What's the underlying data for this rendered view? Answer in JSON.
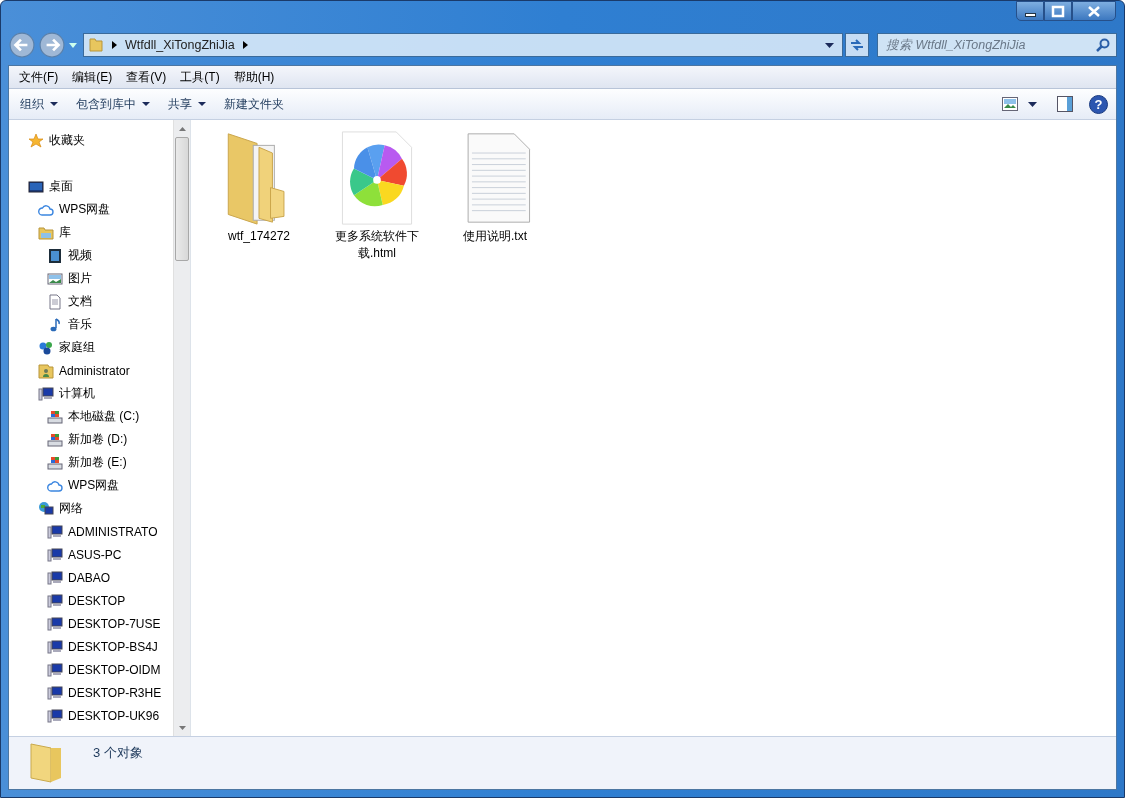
{
  "address_bar": {
    "path": "Wtfdll_XiTongZhiJia"
  },
  "search": {
    "placeholder": "搜索 Wtfdll_XiTongZhiJia"
  },
  "menu_bar": [
    "文件(F)",
    "编辑(E)",
    "查看(V)",
    "工具(T)",
    "帮助(H)"
  ],
  "toolbar": [
    {
      "label": "组织",
      "dropdown": true
    },
    {
      "label": "包含到库中",
      "dropdown": true
    },
    {
      "label": "共享",
      "dropdown": true
    },
    {
      "label": "新建文件夹",
      "dropdown": false
    }
  ],
  "help_button": {
    "label": "?"
  },
  "sidebar": {
    "groups": [
      {
        "items": [
          {
            "label": "收藏夹",
            "kind": "star"
          }
        ]
      },
      {
        "items": [
          {
            "label": "桌面",
            "kind": "desktop",
            "children": [
              {
                "label": "WPS网盘",
                "kind": "cloud"
              },
              {
                "label": "库",
                "kind": "library",
                "children": [
                  {
                    "label": "视频",
                    "kind": "video"
                  },
                  {
                    "label": "图片",
                    "kind": "picture"
                  },
                  {
                    "label": "文档",
                    "kind": "document"
                  },
                  {
                    "label": "音乐",
                    "kind": "music"
                  }
                ]
              },
              {
                "label": "家庭组",
                "kind": "homegroup"
              },
              {
                "label": "Administrator",
                "kind": "user"
              },
              {
                "label": "计算机",
                "kind": "computer",
                "children": [
                  {
                    "label": "本地磁盘 (C:)",
                    "kind": "drive"
                  },
                  {
                    "label": "新加卷 (D:)",
                    "kind": "drive"
                  },
                  {
                    "label": "新加卷 (E:)",
                    "kind": "drive"
                  },
                  {
                    "label": "WPS网盘",
                    "kind": "cloud"
                  }
                ]
              },
              {
                "label": "网络",
                "kind": "network",
                "children": [
                  {
                    "label": "ADMINISTRATO",
                    "kind": "computer"
                  },
                  {
                    "label": "ASUS-PC",
                    "kind": "computer"
                  },
                  {
                    "label": "DABAO",
                    "kind": "computer"
                  },
                  {
                    "label": "DESKTOP",
                    "kind": "computer"
                  },
                  {
                    "label": "DESKTOP-7USE",
                    "kind": "computer"
                  },
                  {
                    "label": "DESKTOP-BS4J",
                    "kind": "computer"
                  },
                  {
                    "label": "DESKTOP-OIDM",
                    "kind": "computer"
                  },
                  {
                    "label": "DESKTOP-R3HE",
                    "kind": "computer"
                  },
                  {
                    "label": "DESKTOP-UK96",
                    "kind": "computer"
                  }
                ]
              }
            ]
          }
        ]
      }
    ]
  },
  "files": [
    {
      "name": "wtf_174272",
      "kind": "folder"
    },
    {
      "name": "更多系统软件下载.html",
      "kind": "html"
    },
    {
      "name": "使用说明.txt",
      "kind": "text"
    }
  ],
  "status_bar": {
    "count": "3 个对象"
  }
}
